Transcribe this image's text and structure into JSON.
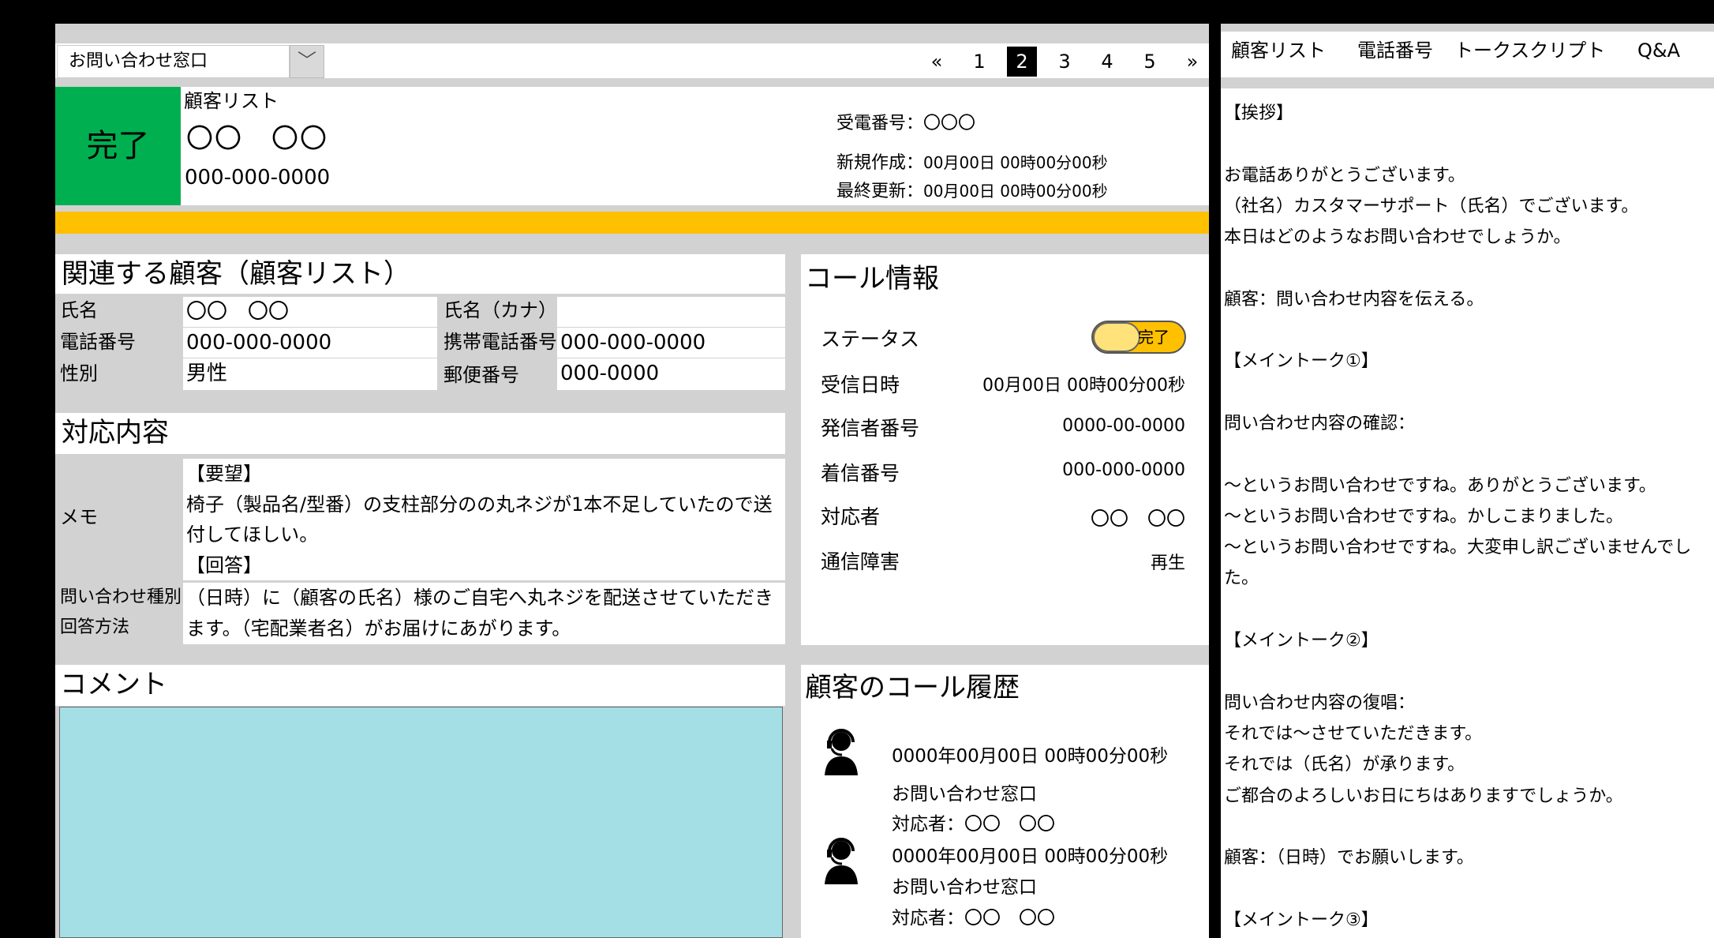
{
  "header": {
    "dropdown_value": "お問い合わせ窓口",
    "pager": [
      "«",
      "1",
      "2",
      "3",
      "4",
      "5",
      "»"
    ],
    "pager_active": "2"
  },
  "record": {
    "status_label": "完了",
    "list_label": "顧客リスト",
    "name": "〇〇　〇〇",
    "phone": "000-000-0000",
    "receive_no_label": "受電番号：",
    "receive_no": "〇〇〇",
    "created_label": "新規作成：",
    "created": "00月00日 00時00分00秒",
    "updated_label": "最終更新：",
    "updated": "00月00日 00時00分00秒"
  },
  "customer": {
    "title": "関連する顧客（顧客リスト）",
    "name_label": "氏名",
    "name": "〇〇　〇〇",
    "kana_label": "氏名（カナ）",
    "kana": "",
    "phone_label": "電話番号",
    "phone": "000-000-0000",
    "mobile_label": "携帯電話番号",
    "mobile": "000-000-0000",
    "gender_label": "性別",
    "gender": "男性",
    "postal_label": "郵便番号",
    "postal": "000-0000"
  },
  "response": {
    "title": "対応内容",
    "memo_label": "メモ",
    "memo_lines": [
      "【要望】",
      "椅子（製品名/型番）の支柱部分のの丸ネジが1本不足していたので送",
      "付してほしい。",
      "【回答】"
    ],
    "type_label": "問い合わせ種別",
    "method_label": "回答方法",
    "method_lines": [
      "（日時）に（顧客の氏名）様のご自宅へ丸ネジを配送させていただき",
      "ます。（宅配業者名）がお届けにあがります。"
    ]
  },
  "call_info": {
    "title": "コール情報",
    "status_label": "ステータス",
    "status_value": "完了",
    "received_label": "受信日時",
    "received": "00月00日 00時00分00秒",
    "caller_label": "発信者番号",
    "caller": "0000-00-0000",
    "callee_label": "着信番号",
    "callee": "000-000-0000",
    "agent_label": "対応者",
    "agent": "〇〇　〇〇",
    "fault_label": "通信障害",
    "fault": "再生"
  },
  "comment": {
    "title": "コメント",
    "box_color": "#a4dfe6"
  },
  "history": {
    "title": "顧客のコール履歴",
    "items": [
      {
        "datetime": "0000年00月00日 00時00分00秒",
        "channel": "お問い合わせ窓口",
        "agent": "対応者：〇〇　〇〇"
      },
      {
        "datetime": "0000年00月00日 00時00分00秒",
        "channel": "お問い合わせ窓口",
        "agent": "対応者：〇〇　〇〇"
      }
    ]
  },
  "right_pane": {
    "tabs": [
      "顧客リスト",
      "電話番号",
      "トークスクリプト",
      "Q&A"
    ],
    "script": "【挨拶】\n\nお電話ありがとうございます。\n（社名）カスタマーサポート（氏名）でございます。\n本日はどのようなお問い合わせでしょうか。\n\n顧客：問い合わせ内容を伝える。\n\n【メイントーク①】\n\n問い合わせ内容の確認：\n\n～というお問い合わせですね。ありがとうございます。\n～というお問い合わせですね。かしこまりました。\n～というお問い合わせですね。大変申し訳ございませんでした。\n\n【メイントーク②】\n\n問い合わせ内容の復唱：\nそれでは～させていただきます。\nそれでは（氏名）が承ります。\nご都合のよろしいお日にちはありますでしょうか。\n\n顧客：（日時）でお願いします。\n\n【メイントーク③】"
  }
}
